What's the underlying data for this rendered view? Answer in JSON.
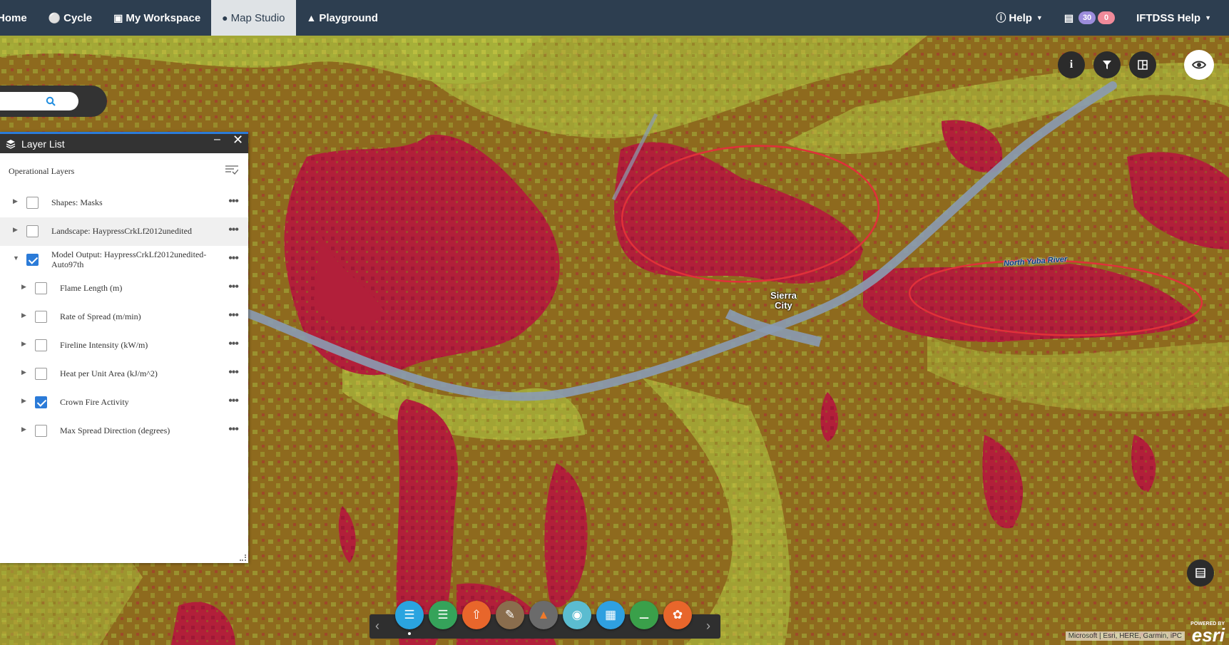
{
  "nav": {
    "items": [
      {
        "label": "Home",
        "icon": "home-icon"
      },
      {
        "label": "Cycle",
        "icon": "cycle-icon"
      },
      {
        "label": "My Workspace",
        "icon": "workspace-icon"
      },
      {
        "label": "Map Studio",
        "icon": "globe-icon"
      },
      {
        "label": "Playground",
        "icon": "flame-icon"
      }
    ],
    "active": "Map Studio",
    "help_label": "Help",
    "notifications": {
      "count_a": "30",
      "count_b": "0"
    },
    "user_label": "IFTDSS Help"
  },
  "search": {
    "placeholder": ""
  },
  "layer_list": {
    "title": "Layer List",
    "section": "Operational Layers",
    "layers": [
      {
        "label": "Shapes: Masks",
        "checked": false
      },
      {
        "label": "Landscape: HaypressCrkLf2012unedited",
        "checked": false
      },
      {
        "label": "Model Output: HaypressCrkLf2012unedited-Auto97th",
        "checked": true
      },
      {
        "label": "Flame Length (m)",
        "checked": false
      },
      {
        "label": "Rate of Spread (m/min)",
        "checked": false
      },
      {
        "label": "Fireline Intensity (kW/m)",
        "checked": false
      },
      {
        "label": "Heat per Unit Area (kJ/m^2)",
        "checked": false
      },
      {
        "label": "Crown Fire Activity",
        "checked": true
      },
      {
        "label": "Max Spread Direction (degrees)",
        "checked": false
      }
    ]
  },
  "map": {
    "town_label_1": "Sierra",
    "town_label_2": "City",
    "river_label": "North Yuba River",
    "attribution": "Microsoft | Esri, HERE, Garmin, iPC",
    "esri_powered": "POWERED BY",
    "esri_logo": "esri"
  },
  "colors": {
    "nav_bg": "#2d3e50",
    "accent": "#2b7bd8",
    "crown_fire": "#b21f3a",
    "surface_fire": "#8e6a1e",
    "passive": "#a7b33a"
  },
  "toolbar": {
    "tools": [
      {
        "name": "layers-tool-icon",
        "color": "#2aa4e0"
      },
      {
        "name": "basemap-tool-icon",
        "color": "#35a35a"
      },
      {
        "name": "upload-tool-icon",
        "color": "#e8662b"
      },
      {
        "name": "edit-tool-icon",
        "color": "#8a6d4d"
      },
      {
        "name": "fire-tool-icon",
        "color": "#6b6b6b"
      },
      {
        "name": "location-tool-icon",
        "color": "#5bbcd0"
      },
      {
        "name": "grid-tool-icon",
        "color": "#2fa0e0"
      },
      {
        "name": "measure-tool-icon",
        "color": "#3aa04a"
      },
      {
        "name": "palette-tool-icon",
        "color": "#e8662b"
      }
    ]
  }
}
